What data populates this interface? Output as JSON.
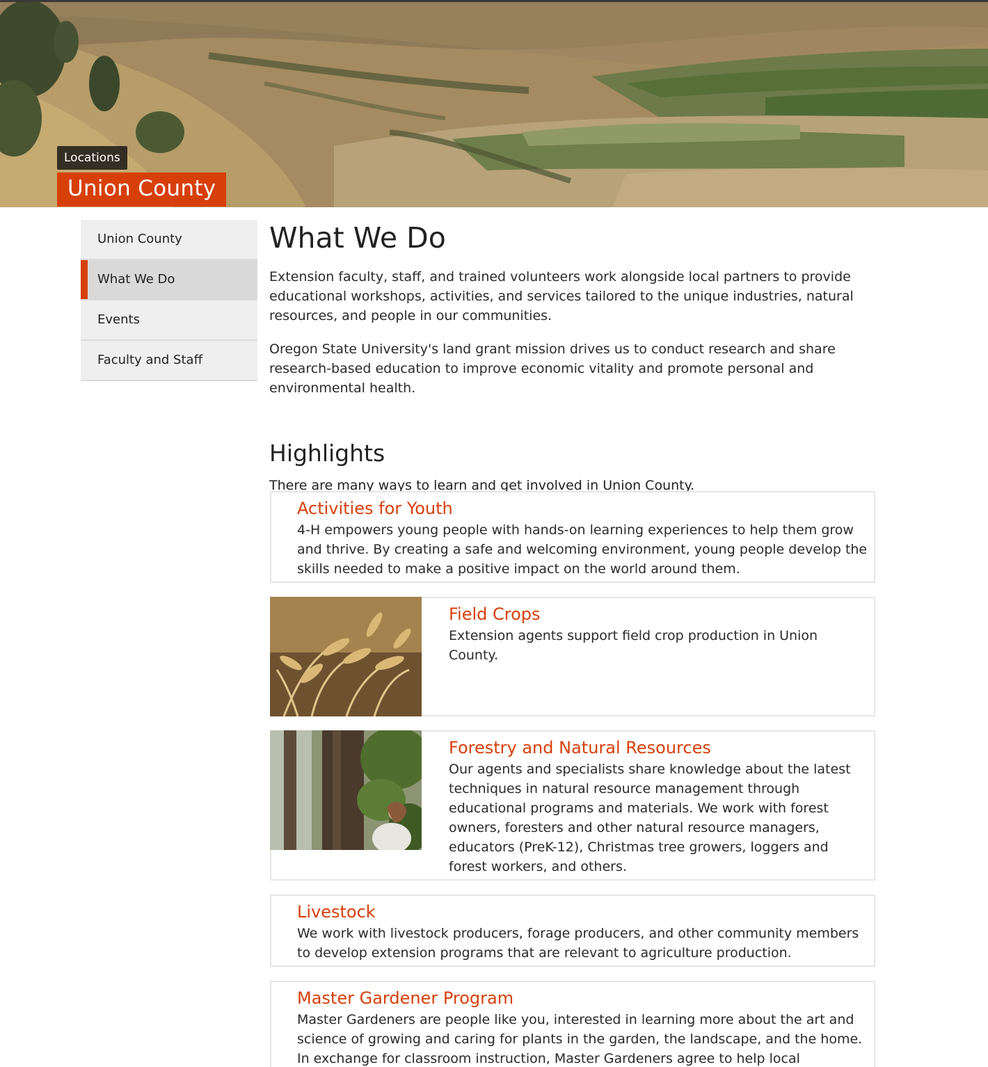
{
  "hero": {
    "breadcrumb": "Locations",
    "title": "Union County"
  },
  "sidenav": {
    "items": [
      {
        "label": "Union County",
        "active": false
      },
      {
        "label": "What We Do",
        "active": true
      },
      {
        "label": "Events",
        "active": false
      },
      {
        "label": "Faculty and Staff",
        "active": false
      }
    ]
  },
  "main": {
    "title": "What We Do",
    "intro": [
      "Extension faculty, staff, and trained volunteers work alongside local partners to provide educational workshops, activities, and services tailored to the unique industries, natural resources, and people in our communities.",
      "Oregon State University's land grant mission drives us to conduct research and share research-based education to improve economic vitality and promote personal and environmental health."
    ],
    "highlights_title": "Highlights",
    "highlights_sub": "There are many ways to learn and get involved in Union County.",
    "cards": [
      {
        "title": "Activities for Youth",
        "desc": "4-H empowers young people with hands-on learning experiences to help them grow and thrive. By creating a safe and welcoming environment, young people develop the skills needed to make a positive impact on the world around them."
      },
      {
        "title": "Field Crops",
        "desc": "Extension agents support field crop production in Union County."
      },
      {
        "title": "Forestry and Natural Resources",
        "desc": "Our agents and specialists share knowledge about the latest techniques in natural resource management through educational programs and materials. We work with forest owners, foresters and other natural resource managers, educators (PreK-12), Christmas tree growers, loggers and forest workers, and others."
      },
      {
        "title": "Livestock",
        "desc": "We work with livestock producers, forage producers, and other community members to develop extension programs that are relevant to agriculture production."
      },
      {
        "title": "Master Gardener Program",
        "desc": "Master Gardeners are people like you, interested in learning more about the art and science of growing and caring for plants in the garden, the landscape, and the home. In exchange for classroom instruction, Master Gardeners agree to help local Extension"
      }
    ]
  },
  "colors": {
    "accent": "#d73f09",
    "nav_bg": "#efefef",
    "nav_active_bg": "#d9d9d9"
  }
}
